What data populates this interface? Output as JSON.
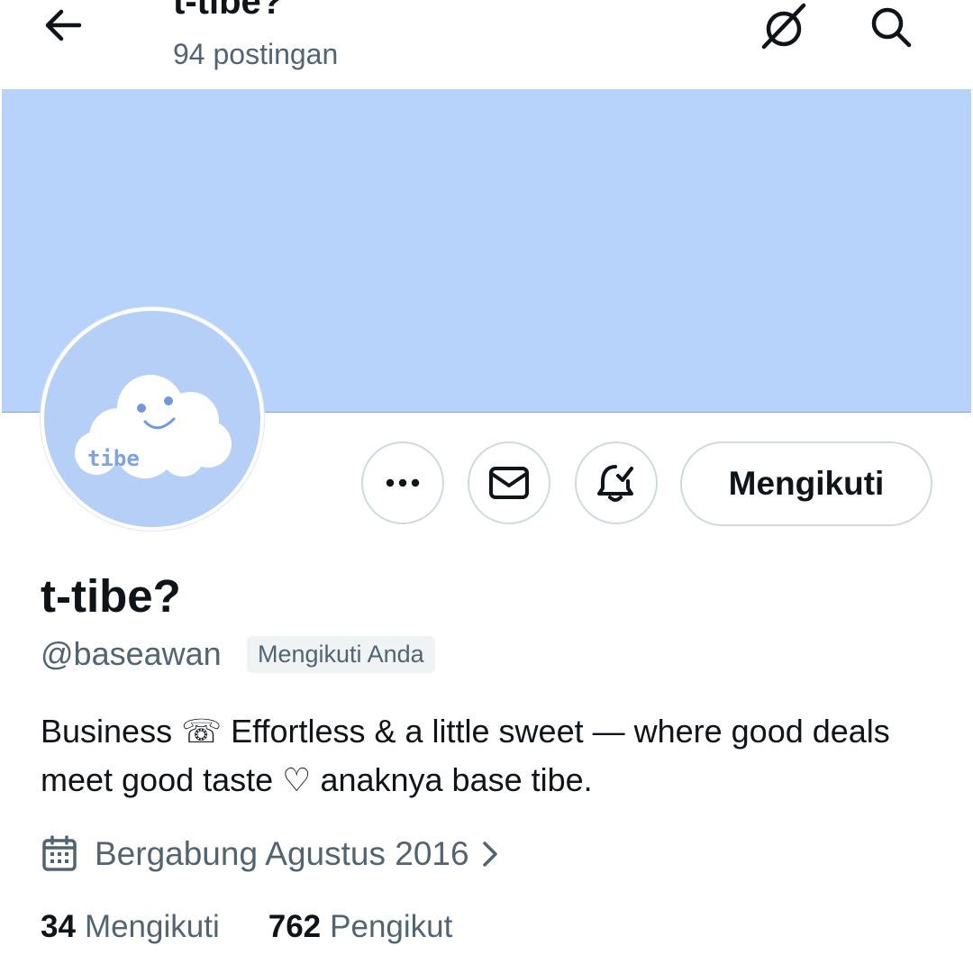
{
  "header": {
    "title": "t-tibe?",
    "post_count": "94 postingan",
    "back_icon": "arrow-left-icon",
    "grok_icon": "grok-icon",
    "search_icon": "search-icon"
  },
  "profile": {
    "banner_color": "#b8d3fb",
    "avatar_text": "tibe",
    "display_name": "t-tibe?",
    "handle": "@baseawan",
    "follows_you_badge": "Mengikuti Anda",
    "bio": "Business ☏ Effortless & a little sweet — where good deals meet good taste ♡ anaknya base tibe.",
    "joined": "Bergabung Agustus 2016"
  },
  "actions": {
    "more_icon": "more-icon",
    "message_icon": "envelope-icon",
    "notify_icon": "bell-check-icon",
    "follow_label": "Mengikuti"
  },
  "stats": {
    "following_count": "34",
    "following_label": "Mengikuti",
    "followers_count": "762",
    "followers_label": "Pengikut"
  }
}
